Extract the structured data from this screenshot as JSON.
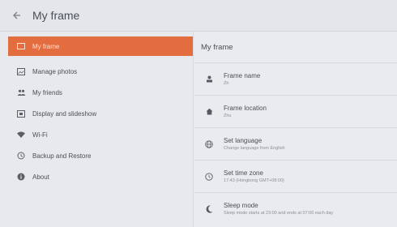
{
  "appbar": {
    "title": "My frame",
    "back_icon": "arrow-left-icon"
  },
  "sidebar": {
    "items": [
      {
        "label": "My frame",
        "icon": "frame-icon",
        "active": true
      },
      {
        "label": "Manage photos",
        "icon": "photos-icon"
      },
      {
        "label": "My friends",
        "icon": "friends-icon"
      },
      {
        "label": "Display and slideshow",
        "icon": "display-icon"
      },
      {
        "label": "Wi-Fi",
        "icon": "wifi-icon"
      },
      {
        "label": "Backup and Restore",
        "icon": "backup-icon"
      },
      {
        "label": "About",
        "icon": "info-icon"
      }
    ]
  },
  "main": {
    "title": "My frame",
    "rows": [
      {
        "title": "Frame name",
        "subtitle": "Zh",
        "icon": "person-icon"
      },
      {
        "title": "Frame location",
        "subtitle": "Zhu",
        "icon": "home-icon"
      },
      {
        "title": "Set language",
        "subtitle": "Change language from English",
        "icon": "globe-icon"
      },
      {
        "title": "Set time zone",
        "subtitle": "17:43 (Hongkong GMT+08:00)",
        "icon": "clock-icon"
      },
      {
        "title": "Sleep mode",
        "subtitle": "Sleep mode starts at 23:00 and ends at 07:00 each day",
        "icon": "moon-icon"
      }
    ]
  },
  "colors": {
    "accent": "#e46d3f",
    "background": "#e9ebee"
  }
}
